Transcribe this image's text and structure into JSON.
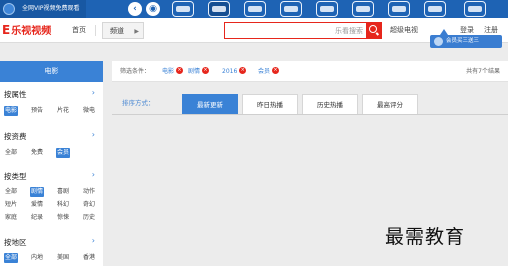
{
  "topbar": {
    "promo_text": "全网VIP视频免费观看",
    "back_icon": "back-arrow-icon",
    "app_icons": [
      "tv-icon",
      "live-icon",
      "movie-icon",
      "play-icon",
      "chat-icon",
      "pay-icon",
      "film-icon",
      "game-icon"
    ]
  },
  "nav": {
    "brand": "乐视视频",
    "brand_mark": "E",
    "home": "首页",
    "channel_dropdown": "频道",
    "search_placeholder": "乐看搜索",
    "super_tv": "超级电视",
    "login": "登录",
    "register": "注册",
    "user_tag": "会员买三送三"
  },
  "sidebar": {
    "header": "电影",
    "groups": [
      {
        "title": "按属性",
        "options": [
          "电影",
          "预告",
          "片花",
          "微电"
        ],
        "selected": 0
      },
      {
        "title": "按资费",
        "options": [
          "全部",
          "免费",
          "会员"
        ],
        "selected": 2
      },
      {
        "title": "按类型",
        "options": [
          "全部",
          "剧情",
          "喜剧",
          "动作",
          "短片",
          "爱情",
          "科幻",
          "奇幻",
          "家庭",
          "纪录",
          "惊悚",
          "历史"
        ],
        "selected": 1
      },
      {
        "title": "按地区",
        "options": [
          "全部",
          "内地",
          "美国",
          "香港"
        ],
        "selected": 0
      }
    ]
  },
  "filter": {
    "label": "筛选条件：",
    "tags": [
      "电影",
      "剧情",
      "2016",
      "会员"
    ],
    "result_count": "共有7个结果"
  },
  "sort": {
    "label": "排序方式：",
    "tabs": [
      "最新更新",
      "昨日热播",
      "历史热播",
      "最高评分"
    ],
    "active_index": 0
  },
  "watermark": "最需教育",
  "colors": {
    "topbar": "#1e63b4",
    "brand_red": "#e6261c",
    "accent_blue": "#3a82d6",
    "page_bg": "#ececec"
  }
}
